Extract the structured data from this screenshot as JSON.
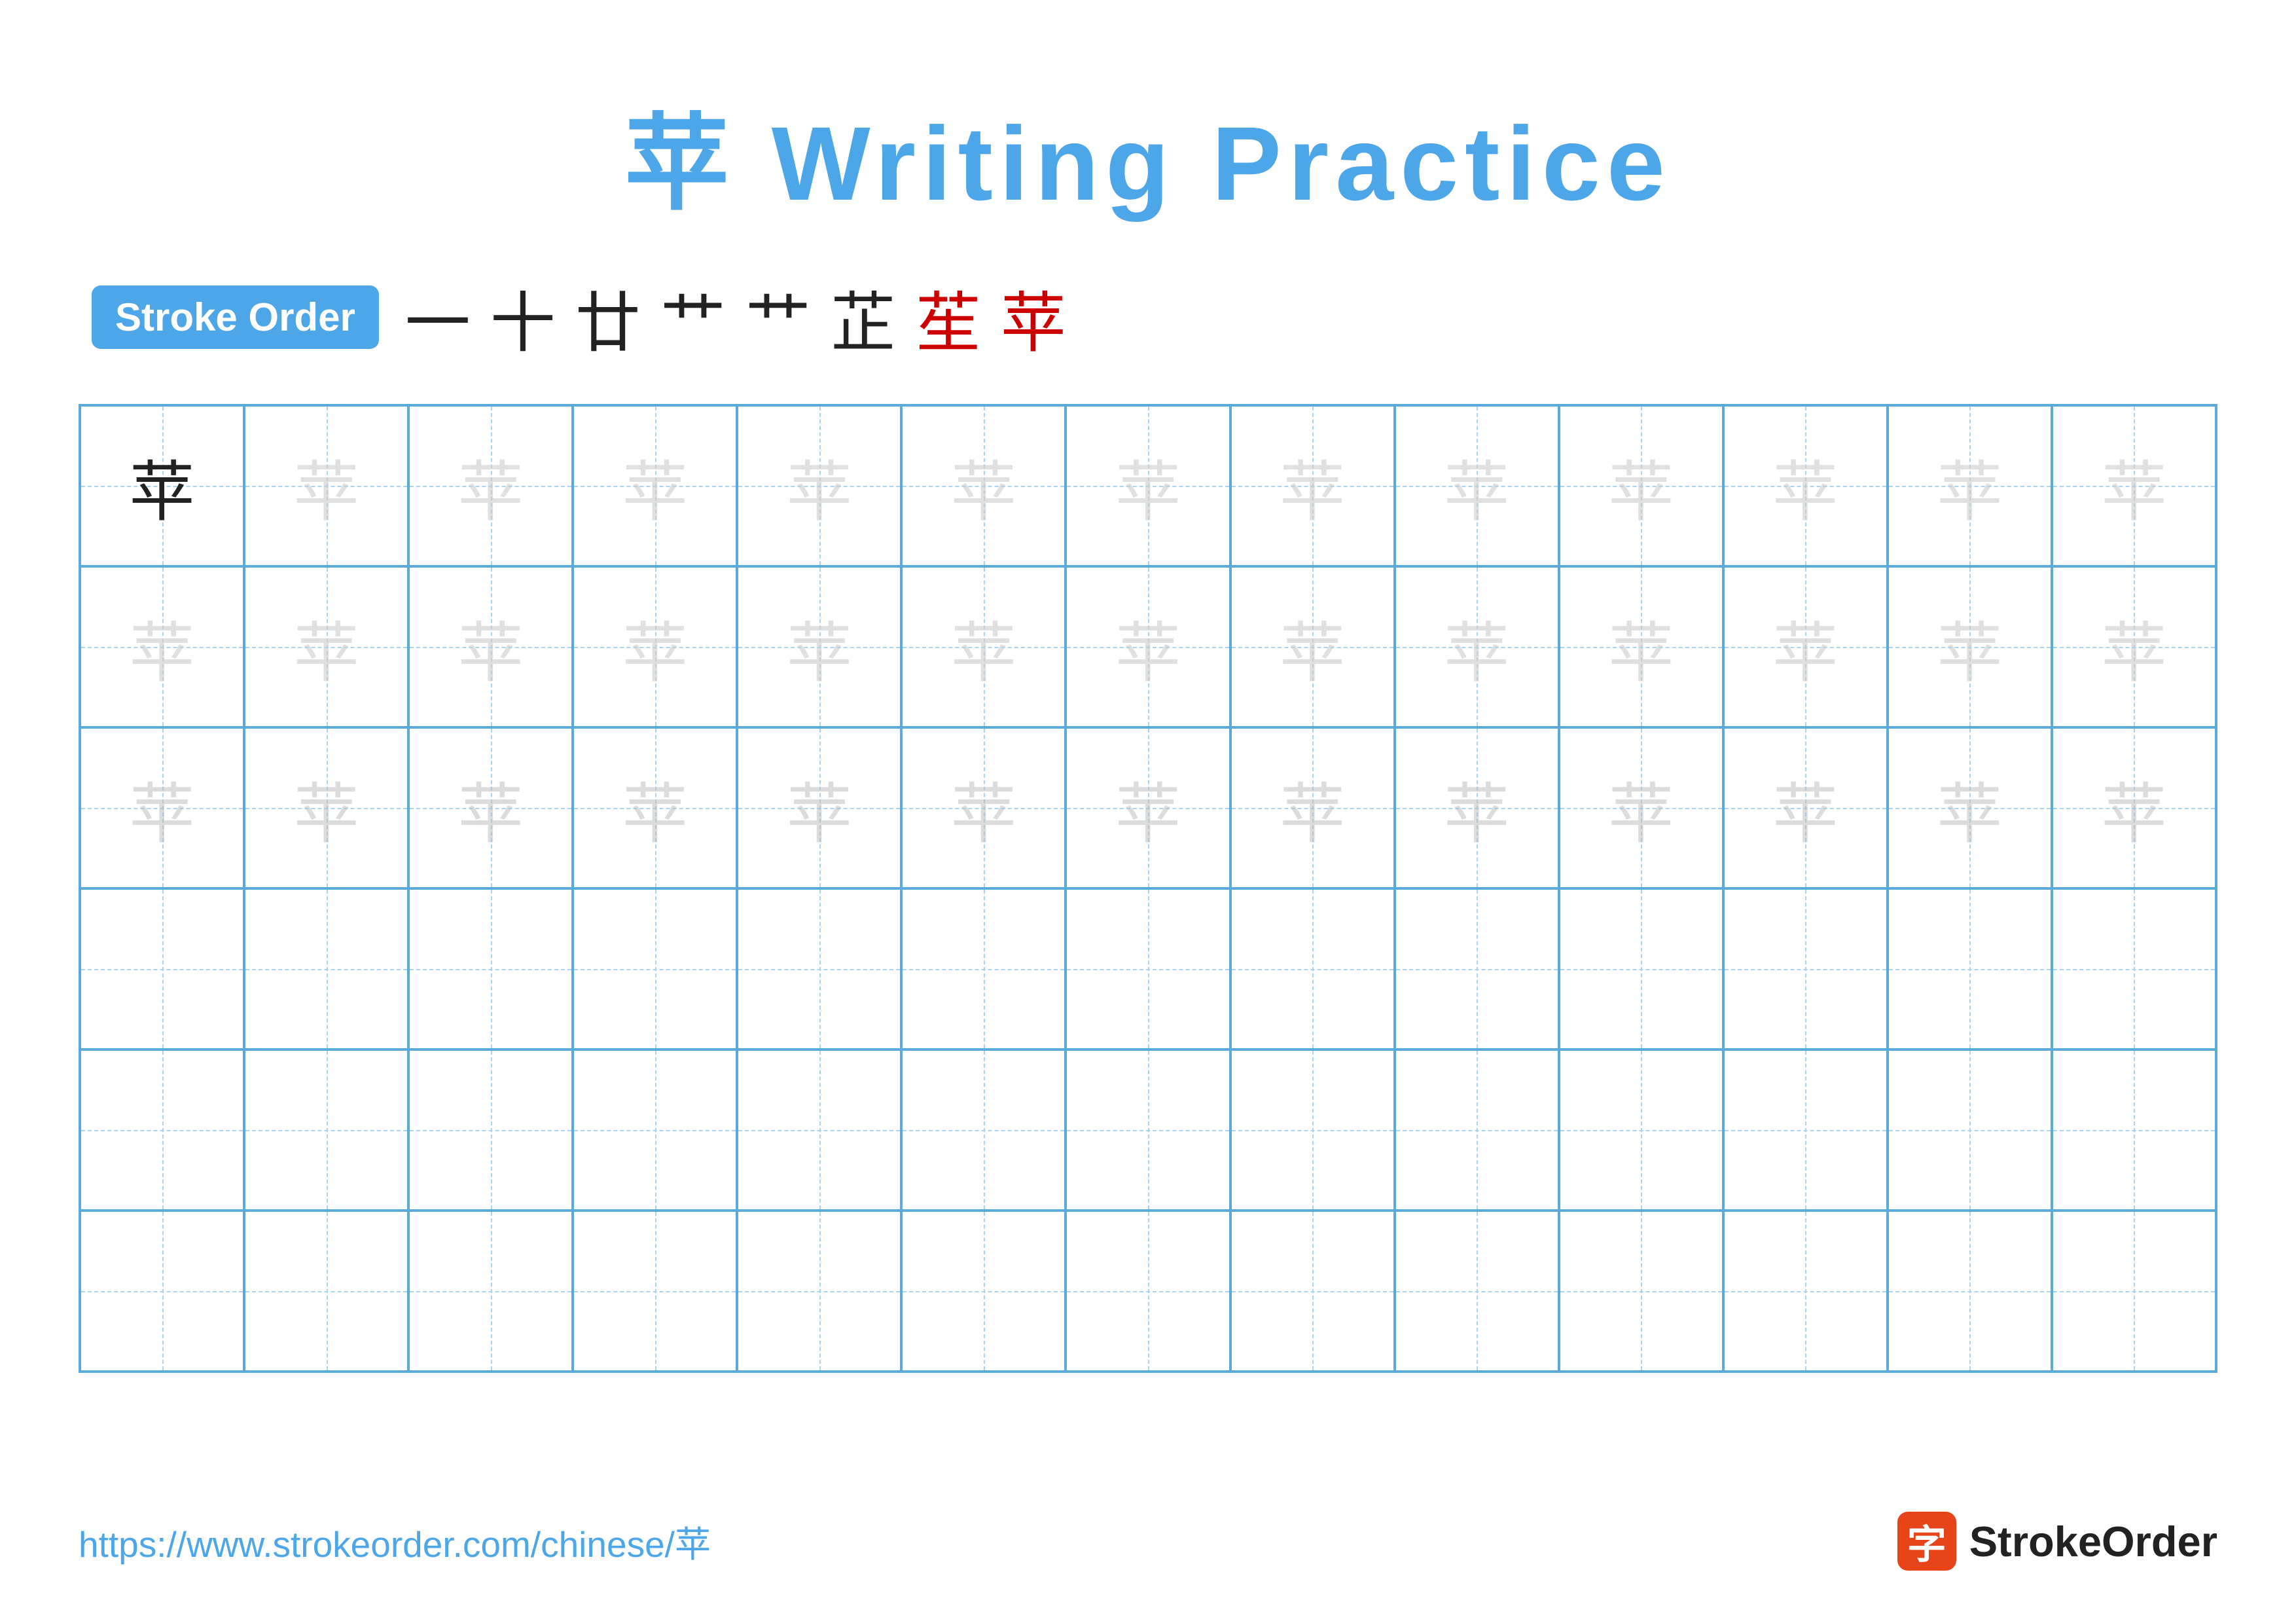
{
  "title": {
    "character": "苹",
    "text": "Writing Practice",
    "full": "苹 Writing Practice"
  },
  "stroke_order": {
    "badge_label": "Stroke Order",
    "strokes": [
      "一",
      "十",
      "廿",
      "艹",
      "艹",
      "芷",
      "苼",
      "苹"
    ]
  },
  "grid": {
    "rows": 6,
    "cols": 13,
    "character": "苹",
    "filled_rows": 3,
    "empty_rows": 3
  },
  "footer": {
    "url": "https://www.strokeorder.com/chinese/苹",
    "logo_char": "字",
    "logo_name": "StrokeOrder"
  }
}
